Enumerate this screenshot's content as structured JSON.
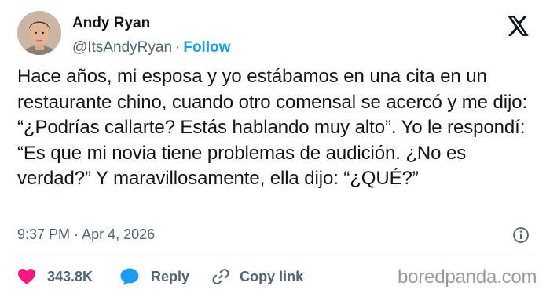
{
  "author": {
    "display_name": "Andy Ryan",
    "handle": "@ItsAndyRyan",
    "separator": "·",
    "follow_label": "Follow"
  },
  "tweet": {
    "text": "Hace años, mi esposa y yo estábamos en una cita en un restaurante chino, cuando otro comensal se acercó y me dijo: “¿Podrías callarte? Estás hablando muy alto”. Yo le respondí: “Es que mi novia tiene problemas de audición. ¿No es verdad?” Y maravillosamente, ella dijo: “¿QUÉ?”",
    "time": "9:37 PM",
    "separator": "·",
    "date": "Apr 4, 2026"
  },
  "actions": {
    "likes": "343.8K",
    "reply_label": "Reply",
    "copy_link_label": "Copy link"
  },
  "watermark": "boredpanda.com",
  "icons": {
    "platform": "x-logo-icon",
    "info": "info-icon",
    "like": "heart-icon",
    "reply": "reply-bubble-icon",
    "copy": "link-icon"
  },
  "colors": {
    "text": "#0f1419",
    "secondary": "#536471",
    "accent": "#1d9bf0",
    "like": "#f91880",
    "divider": "#eff3f4"
  }
}
